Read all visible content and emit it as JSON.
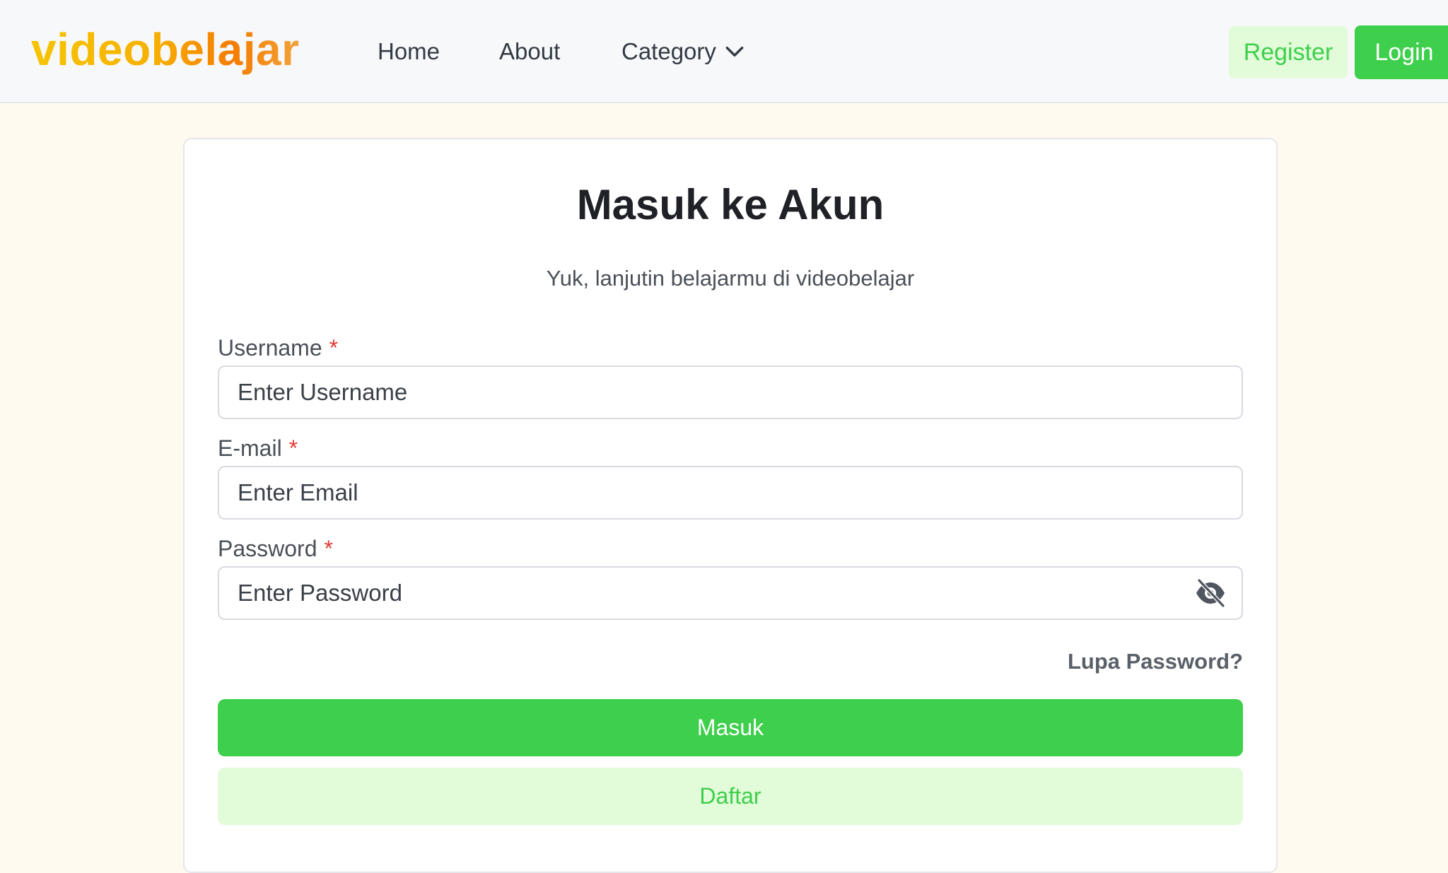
{
  "brand": {
    "logo_text": "videobelajar",
    "accent": "#3ecf4c",
    "accent_light": "#e2fbd9"
  },
  "nav": {
    "home": "Home",
    "about": "About",
    "category": "Category",
    "register": "Register",
    "login": "Login"
  },
  "form": {
    "title": "Masuk ke Akun",
    "subtitle": "Yuk, lanjutin belajarmu di videobelajar",
    "required_marker": "*",
    "username": {
      "label": "Username",
      "placeholder": "Enter Username",
      "value": ""
    },
    "email": {
      "label": "E-mail",
      "placeholder": "Enter Email",
      "value": ""
    },
    "password": {
      "label": "Password",
      "placeholder": "Enter Password",
      "value": "",
      "toggle_icon": "eye-slash-icon"
    },
    "forgot": "Lupa Password?",
    "submit": "Masuk",
    "register": "Daftar"
  }
}
